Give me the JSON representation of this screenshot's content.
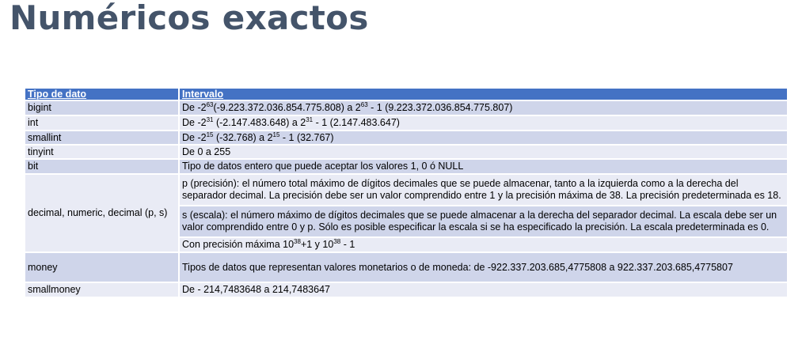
{
  "page": {
    "title": "Numéricos exactos"
  },
  "table": {
    "headers": [
      "Tipo de dato",
      "Intervalo"
    ],
    "rows": [
      {
        "type": "bigint",
        "range": {
          "a": "De -2",
          "b": "63",
          "c": "(-9.223.372.036.854.775.808) a 2",
          "d": "63",
          "e": " - 1 (9.223.372.036.854.775.807)"
        }
      },
      {
        "type": "int",
        "range": {
          "a": "De -2",
          "b": "31",
          "c": " (-2.147.483.648) a 2",
          "d": "31",
          "e": " - 1 (2.147.483.647)"
        }
      },
      {
        "type": "smallint",
        "range": {
          "a": "De -2",
          "b": "15",
          "c": " (-32.768) a 2",
          "d": "15",
          "e": " - 1 (32.767)"
        }
      },
      {
        "type": "tinyint",
        "range": "De 0 a 255"
      },
      {
        "type": "bit",
        "range": "Tipo de datos entero que puede aceptar los valores 1, 0 ó NULL"
      },
      {
        "type": "decimal, numeric, decimal (p, s)",
        "precision": "p (precisión): el número total máximo de dígitos decimales que se puede almacenar, tanto a la izquierda como a la derecha del separador decimal. La precisión debe ser un valor comprendido entre 1 y la precisión máxima de 38. La precisión predeterminada es 18.",
        "scale": "s (escala): el número máximo de dígitos decimales que se puede almacenar a la derecha del separador decimal. La escala debe ser un valor comprendido entre 0 y p. Sólo es posible especificar la escala si se ha especificado la precisión. La escala predeterminada es 0.",
        "max": {
          "a": "Con precisión máxima 10",
          "b": "38",
          "c": "+1 y 10",
          "d": "38",
          "e": " - 1"
        }
      },
      {
        "type": "money",
        "range": "Tipos de datos que representan valores monetarios o de moneda: de -922.337.203.685,4775808 a 922.337.203.685,4775807"
      },
      {
        "type": "smallmoney",
        "range": "De - 214,7483648 a 214,7483647"
      }
    ]
  }
}
